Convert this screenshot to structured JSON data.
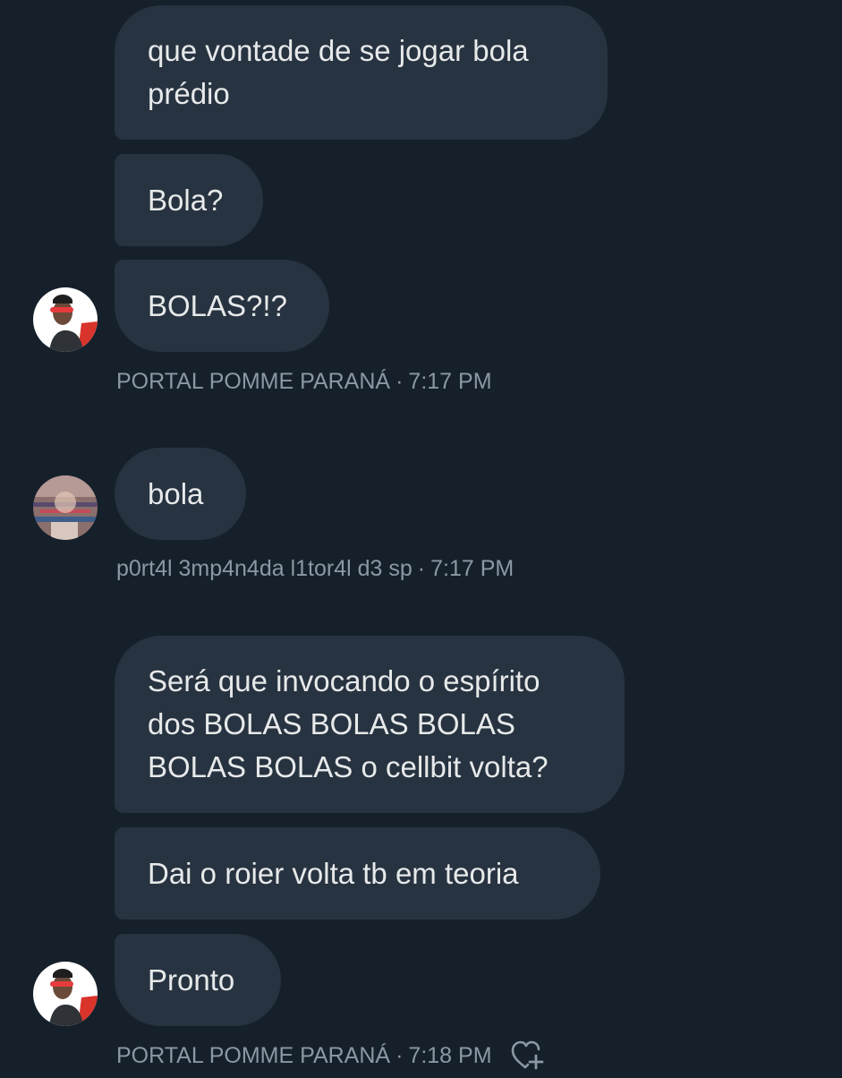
{
  "messages": [
    {
      "text": "que vontade de se jogar bola\nprédio"
    },
    {
      "text": "Bola?"
    },
    {
      "text": "BOLAS?!?"
    },
    {
      "text": "bola"
    },
    {
      "text": "Será que invocando o espírito\ndos BOLAS BOLAS BOLAS\nBOLAS BOLAS o cellbit volta?"
    },
    {
      "text": "Dai o roier volta tb em teoria"
    },
    {
      "text": "Pronto"
    }
  ],
  "meta": [
    {
      "name": "PORTAL POMME PARANÁ",
      "time": "7:17 PM",
      "separator": "·"
    },
    {
      "name": "p0rt4l 3mp4n4da l1tor4l d3 sp",
      "time": "7:17 PM",
      "separator": "·"
    },
    {
      "name": "PORTAL POMME PARANÁ",
      "time": "7:18 PM",
      "separator": "·"
    }
  ],
  "icons": {
    "react": "heart-plus-icon",
    "avatar_1": "user-avatar-icon",
    "avatar_2": "user-avatar-icon"
  },
  "colors": {
    "background": "#15202b",
    "bubble": "#273340",
    "text": "#e7e9ea",
    "meta": "#8b98a5"
  }
}
